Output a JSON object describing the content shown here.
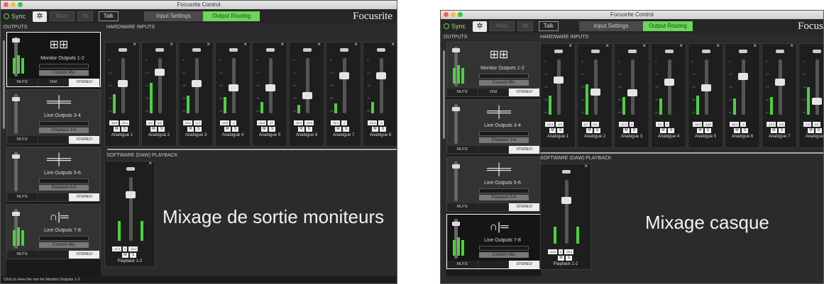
{
  "app_title": "Focusrite Control",
  "toolbar": {
    "sync_label": "Sync",
    "main_label": "Main",
    "alt_label": "Alt",
    "talk_label": "Talk",
    "tabs": [
      "Input Settings",
      "Output Routing"
    ],
    "brand": "Focusrite"
  },
  "sections": {
    "outputs": "OUTPUTS",
    "hardware_inputs": "HARDWARE INPUTS",
    "software_playback": "SOFTWARE (DAW) PLAYBACK"
  },
  "outputs": [
    {
      "name": "Monitor Outputs 1-2",
      "mix": "Custom Mix",
      "buttons": [
        "MUTE",
        "DIM",
        "STEREO"
      ]
    },
    {
      "name": "Line Outputs 3-4",
      "mix": "Playback 3-4",
      "buttons": [
        "MUTE",
        "",
        "STEREO"
      ]
    },
    {
      "name": "Line Outputs 5-6",
      "mix": "Playback 5-6",
      "buttons": [
        "MUTE",
        "",
        "STEREO"
      ]
    },
    {
      "name": "Line Outputs 7-8",
      "mix": "Custom Mix",
      "buttons": [
        "MUTE",
        "",
        "STEREO"
      ]
    }
  ],
  "inputs_left": [
    {
      "name": "Analogue 1",
      "vals": [
        "-18.6",
        "-22.1"
      ],
      "level": 0.55,
      "meter": 0.35
    },
    {
      "name": "Analogue 2",
      "vals": [
        "-6.2",
        "-8.5"
      ],
      "level": 0.78,
      "meter": 0.55
    },
    {
      "name": "Analogue 3",
      "vals": [
        "-10.2",
        "-1.7"
      ],
      "level": 0.55,
      "meter": 0.32
    },
    {
      "name": "Analogue 4",
      "vals": [
        "-15.8",
        "-1"
      ],
      "level": 0.45,
      "meter": 0.3
    },
    {
      "name": "Analogue 5",
      "vals": [
        "-26.8",
        "-17"
      ],
      "level": 0.45,
      "meter": 0.2
    },
    {
      "name": "Analogue 6",
      "vals": [
        "-30.1",
        "-22.5"
      ],
      "level": 0.3,
      "meter": 0.15
    },
    {
      "name": "Analogue 7",
      "vals": [
        "-32.1",
        "-7"
      ],
      "level": 0.7,
      "meter": 0.18
    },
    {
      "name": "Analogue 8",
      "vals": [
        "-29.4",
        "-2"
      ],
      "level": 0.7,
      "meter": 0.2
    }
  ],
  "inputs_right": [
    {
      "name": "Analogue 1",
      "vals": [
        "-15.4",
        "-4.3"
      ],
      "level": 0.65,
      "meter": 0.35
    },
    {
      "name": "Analogue 2",
      "vals": [
        "-8.7",
        "-9.1"
      ],
      "level": 0.4,
      "meter": 0.55
    },
    {
      "name": "Analogue 3",
      "vals": [
        "-17.2",
        "0"
      ],
      "level": 0.38,
      "meter": 0.32
    },
    {
      "name": "Analogue 4",
      "vals": [
        "-9.1",
        "0"
      ],
      "level": 0.6,
      "meter": 0.3
    },
    {
      "name": "Analogue 5",
      "vals": [
        "-16.3",
        "-10.8"
      ],
      "level": 0.48,
      "meter": 0.35
    },
    {
      "name": "Analogue 6",
      "vals": [
        "-18.1",
        "-2"
      ],
      "level": 0.72,
      "meter": 0.3
    },
    {
      "name": "Analogue 7",
      "vals": [
        "-12.2",
        "-5.3"
      ],
      "level": 0.6,
      "meter": 0.32
    },
    {
      "name": "Analogue 8",
      "vals": [
        "-7.9",
        "-3.1"
      ],
      "level": 0.2,
      "meter": 0.5
    }
  ],
  "playback_left": {
    "name": "Playback 1-2",
    "vals": [
      "-21.4",
      "0",
      "-21.4"
    ],
    "level": 0.75,
    "meter": 0.35
  },
  "playback_right": {
    "name": "Playback 1-2",
    "vals": [
      "-20.6",
      "0",
      "-20.1"
    ],
    "level": 0.7,
    "meter": 0.3
  },
  "strip_buttons": [
    "M",
    "S"
  ],
  "captions": {
    "left": "Mixage de sortie moniteurs",
    "right": "Mixage casque"
  },
  "status_text": "Click to view the mix for Monitor Outputs 1-2"
}
